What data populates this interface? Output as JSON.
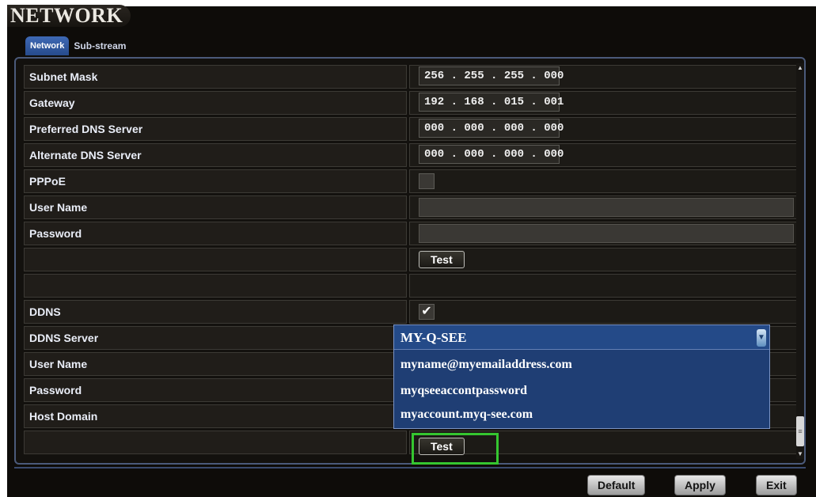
{
  "window": {
    "title": "NETWORK"
  },
  "tabs": [
    {
      "label": "Network",
      "active": true
    },
    {
      "label": "Sub-stream",
      "active": false
    }
  ],
  "settings": {
    "subnet_mask": {
      "label": "Subnet Mask",
      "value": "256 . 255 . 255 . 000"
    },
    "gateway": {
      "label": "Gateway",
      "value": "192 . 168 . 015 . 001"
    },
    "preferred_dns": {
      "label": "Preferred DNS Server",
      "value": "000 . 000 . 000 . 000"
    },
    "alternate_dns": {
      "label": "Alternate DNS Server",
      "value": "000 . 000 . 000 . 000"
    },
    "pppoe": {
      "label": "PPPoE",
      "checked": false
    },
    "pppoe_user": {
      "label": "User Name",
      "value": ""
    },
    "pppoe_password": {
      "label": "Password",
      "value": ""
    },
    "pppoe_test_label": "Test",
    "ddns": {
      "label": "DDNS",
      "checked": true,
      "check_glyph": "✔"
    },
    "ddns_server": {
      "label": "DDNS Server",
      "value": "MY-Q-SEE"
    },
    "ddns_user": {
      "label": "User Name",
      "value": "myname@myemailaddress.com"
    },
    "ddns_password": {
      "label": "Password",
      "value": "myqseeaccontpassword"
    },
    "host_domain": {
      "label": "Host Domain",
      "value": "myaccount.myq-see.com"
    },
    "ddns_test_label": "Test"
  },
  "footer": {
    "default_label": "Default",
    "apply_label": "Apply",
    "exit_label": "Exit"
  },
  "colors": {
    "highlight": "#35c630",
    "dropdown_bg": "#1f3e74",
    "tab_active": "#3e69b5"
  },
  "icons": {
    "dropdown_arrow": "dropdown-arrow-icon",
    "scroll_up": "scroll-up-icon",
    "scroll_down": "scroll-down-icon"
  }
}
